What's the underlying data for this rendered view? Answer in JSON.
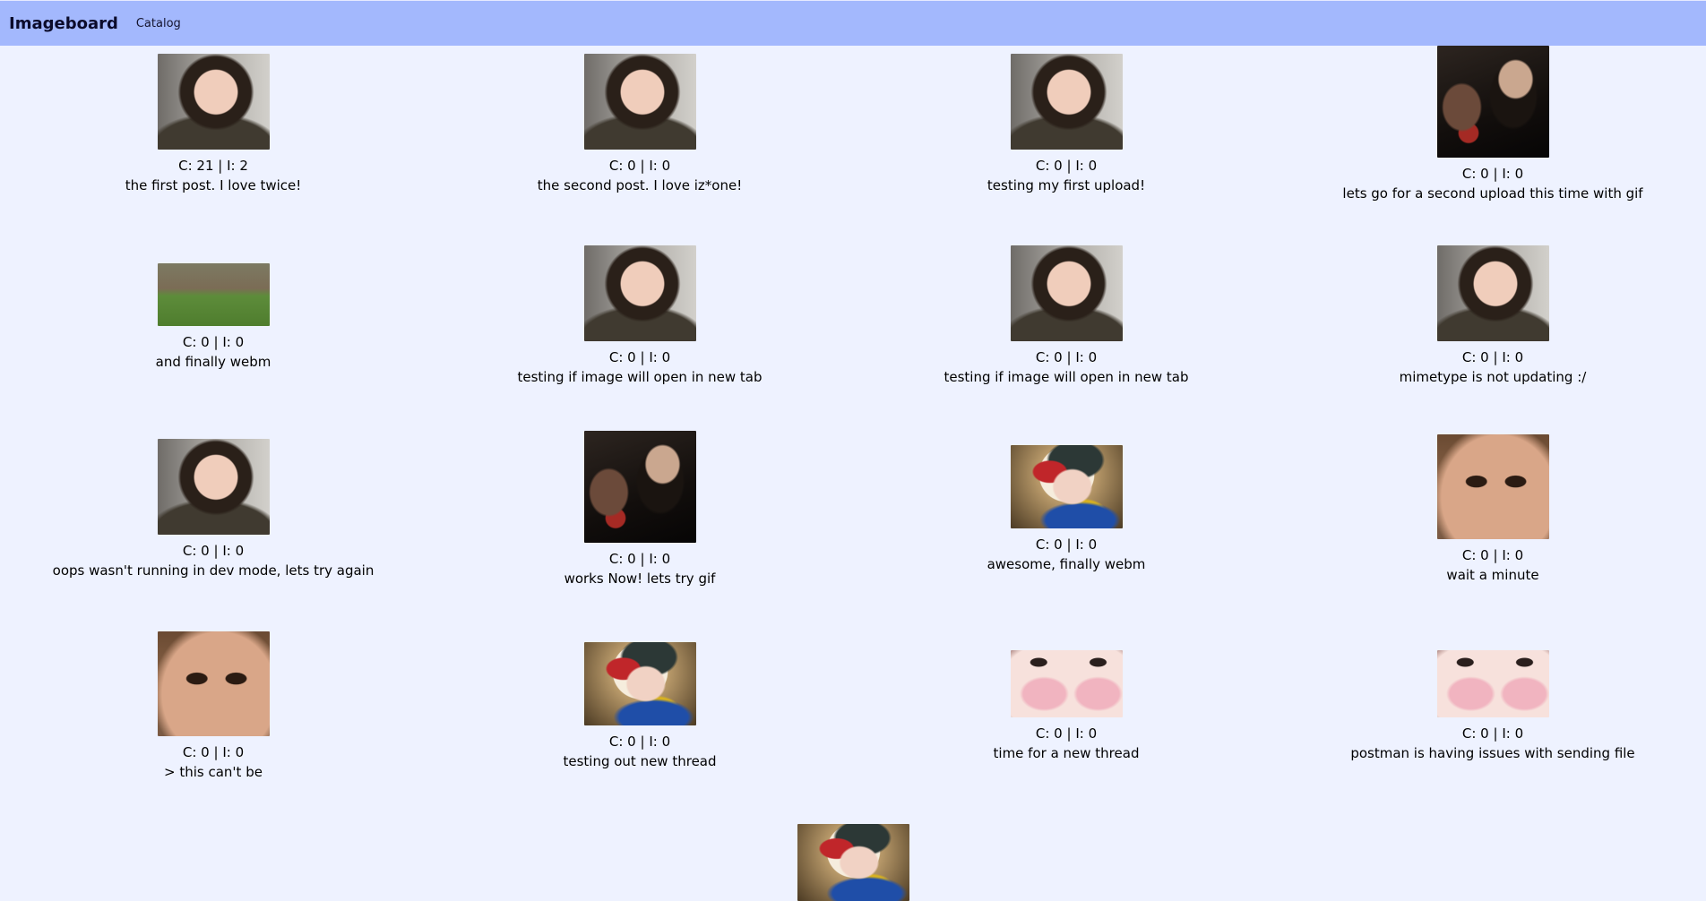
{
  "navbar": {
    "brand": "Imageboard",
    "links": [
      "Catalog"
    ]
  },
  "threads": [
    {
      "stats": "C: 21 | I: 2",
      "subject": "the first post. I love twice!",
      "thumb": "girl-smiling-thumbnail"
    },
    {
      "stats": "C: 0 | I: 0",
      "subject": "the second post. I love iz*one!",
      "thumb": "girl-smiling-thumbnail"
    },
    {
      "stats": "C: 0 | I: 0",
      "subject": "testing my first upload!",
      "thumb": "girl-smiling-thumbnail"
    },
    {
      "stats": "C: 0 | I: 0",
      "subject": "lets go for a second upload this time with gif",
      "thumb": "dark-scene-thumbnail"
    },
    {
      "stats": "C: 0 | I: 0",
      "subject": "and finally webm",
      "thumb": "grass-wall-thumbnail"
    },
    {
      "stats": "C: 0 | I: 0",
      "subject": "testing if image will open in new tab",
      "thumb": "girl-smiling-thumbnail"
    },
    {
      "stats": "C: 0 | I: 0",
      "subject": "testing if image will open in new tab",
      "thumb": "girl-smiling-thumbnail"
    },
    {
      "stats": "C: 0 | I: 0",
      "subject": "mimetype is not updating :/",
      "thumb": "girl-smiling-thumbnail"
    },
    {
      "stats": "C: 0 | I: 0",
      "subject": "oops wasn't running in dev mode, lets try again",
      "thumb": "girl-smiling-thumbnail"
    },
    {
      "stats": "C: 0 | I: 0",
      "subject": "works Now! lets try gif",
      "thumb": "dark-scene-thumbnail"
    },
    {
      "stats": "C: 0 | I: 0",
      "subject": "awesome, finally webm",
      "thumb": "idol-selfie-thumbnail"
    },
    {
      "stats": "C: 0 | I: 0",
      "subject": "wait a minute",
      "thumb": "face-closeup-thumbnail"
    },
    {
      "stats": "C: 0 | I: 0",
      "subject": "> this can't be",
      "thumb": "face-closeup-thumbnail"
    },
    {
      "stats": "C: 0 | I: 0",
      "subject": "testing out new thread",
      "thumb": "idol-selfie-thumbnail"
    },
    {
      "stats": "C: 0 | I: 0",
      "subject": "time for a new thread",
      "thumb": "nose-closeup-thumbnail"
    },
    {
      "stats": "C: 0 | I: 0",
      "subject": "postman is having issues with sending file",
      "thumb": "nose-closeup-thumbnail"
    },
    {
      "stats": "",
      "subject": "",
      "thumb": "idol-selfie-thumbnail"
    }
  ]
}
